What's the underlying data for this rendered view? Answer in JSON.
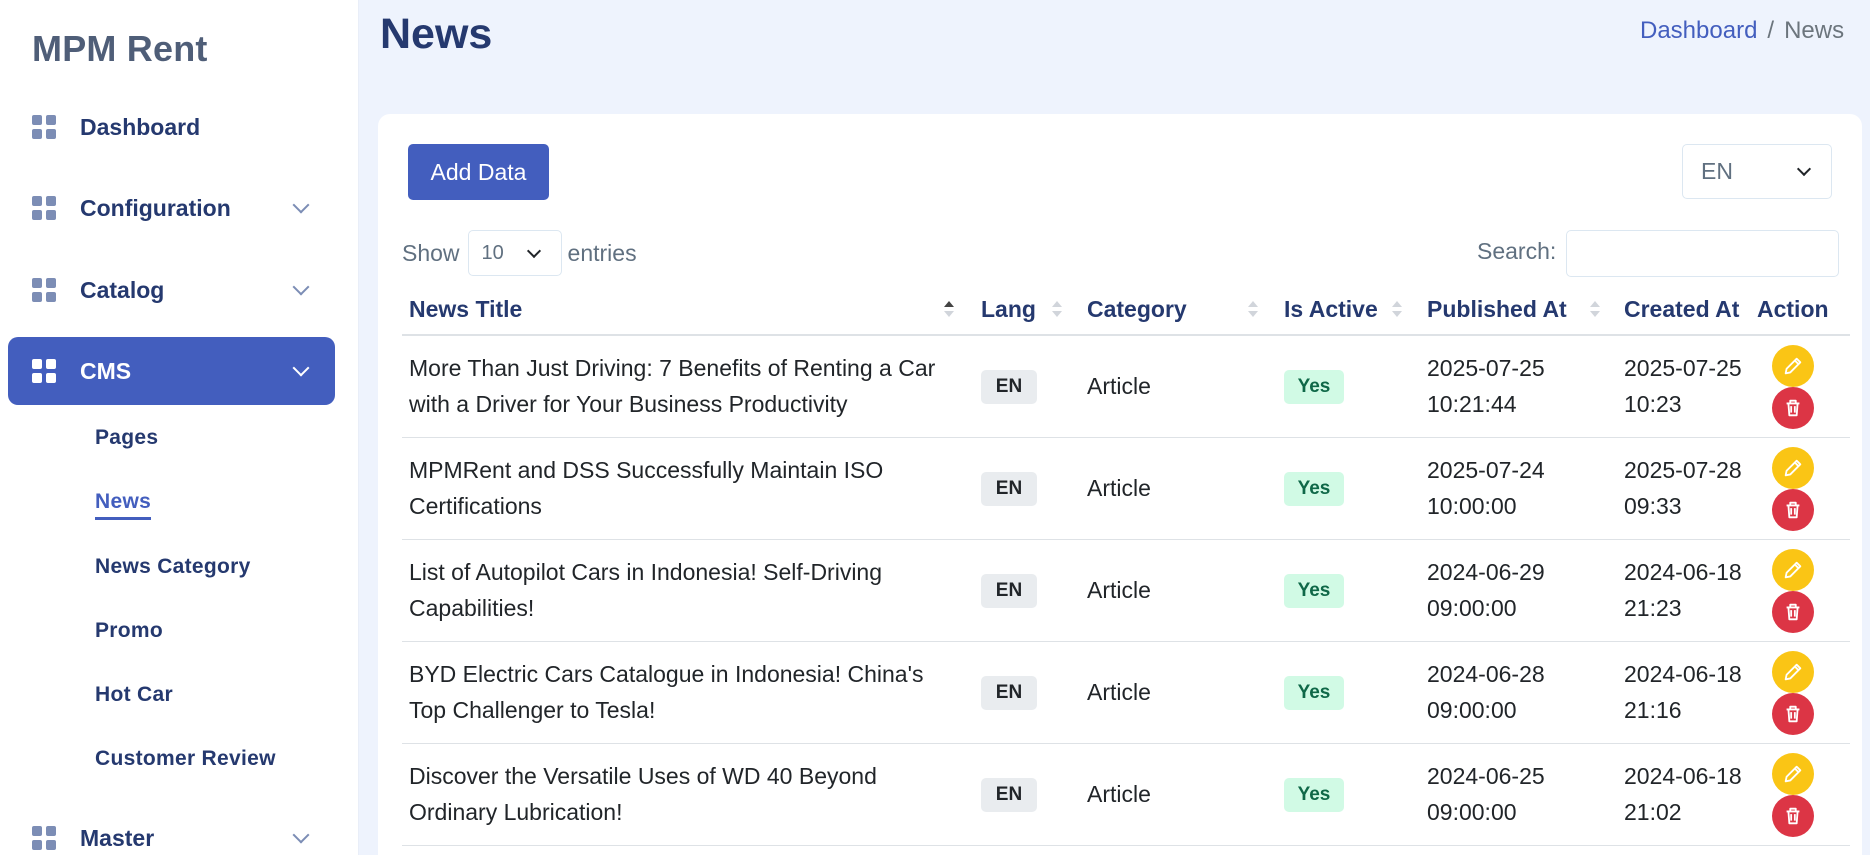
{
  "sidebar": {
    "brand": "MPM Rent",
    "items": [
      {
        "label": "Dashboard"
      },
      {
        "label": "Configuration"
      },
      {
        "label": "Catalog"
      },
      {
        "label": "CMS"
      },
      {
        "label": "Master"
      }
    ],
    "cms_sub": [
      {
        "label": "Pages"
      },
      {
        "label": "News"
      },
      {
        "label": "News Category"
      },
      {
        "label": "Promo"
      },
      {
        "label": "Hot Car"
      },
      {
        "label": "Customer Review"
      }
    ]
  },
  "header": {
    "title": "News",
    "breadcrumb": {
      "home": "Dashboard",
      "separator": "/",
      "current": "News"
    }
  },
  "toolbar": {
    "add_label": "Add Data",
    "lang_value": "EN",
    "show_label": "Show",
    "entries_value": "10",
    "entries_label": "entries",
    "search_label": "Search:",
    "search_value": ""
  },
  "table": {
    "columns": [
      "News Title",
      "Lang",
      "Category",
      "Is Active",
      "Published At",
      "Created At",
      "Action"
    ],
    "rows": [
      {
        "title_1": "More Than Just Driving: 7 Benefits of Renting a Car",
        "title_2": "with a Driver for Your Business Productivity",
        "lang": "EN",
        "category": "Article",
        "active": "Yes",
        "pub_date": "2025-07-25",
        "pub_time": "10:21:44",
        "created_date": "2025-07-25",
        "created_time": "10:23"
      },
      {
        "title_1": "MPMRent and DSS Successfully Maintain ISO",
        "title_2": "Certifications",
        "lang": "EN",
        "category": "Article",
        "active": "Yes",
        "pub_date": "2025-07-24",
        "pub_time": "10:00:00",
        "created_date": "2025-07-28",
        "created_time": "09:33"
      },
      {
        "title_1": "List of Autopilot Cars in Indonesia! Self-Driving",
        "title_2": "Capabilities!",
        "lang": "EN",
        "category": "Article",
        "active": "Yes",
        "pub_date": "2024-06-29",
        "pub_time": "09:00:00",
        "created_date": "2024-06-18",
        "created_time": "21:23"
      },
      {
        "title_1": "BYD Electric Cars Catalogue in Indonesia! China's",
        "title_2": "Top Challenger to Tesla!",
        "lang": "EN",
        "category": "Article",
        "active": "Yes",
        "pub_date": "2024-06-28",
        "pub_time": "09:00:00",
        "created_date": "2024-06-18",
        "created_time": "21:16"
      },
      {
        "title_1": "Discover the Versatile Uses of WD 40 Beyond",
        "title_2": "Ordinary Lubrication!",
        "lang": "EN",
        "category": "Article",
        "active": "Yes",
        "pub_date": "2024-06-25",
        "pub_time": "09:00:00",
        "created_date": "2024-06-18",
        "created_time": "21:02"
      }
    ]
  },
  "icons": {
    "menu": "grid-icon",
    "edit": "pencil-icon",
    "delete": "trash-icon",
    "expand": "chevron-down-icon"
  },
  "colors": {
    "primary": "#435ebe",
    "edit": "#fac515",
    "delete": "#dc3545",
    "active_badge": "#d1fae5"
  }
}
